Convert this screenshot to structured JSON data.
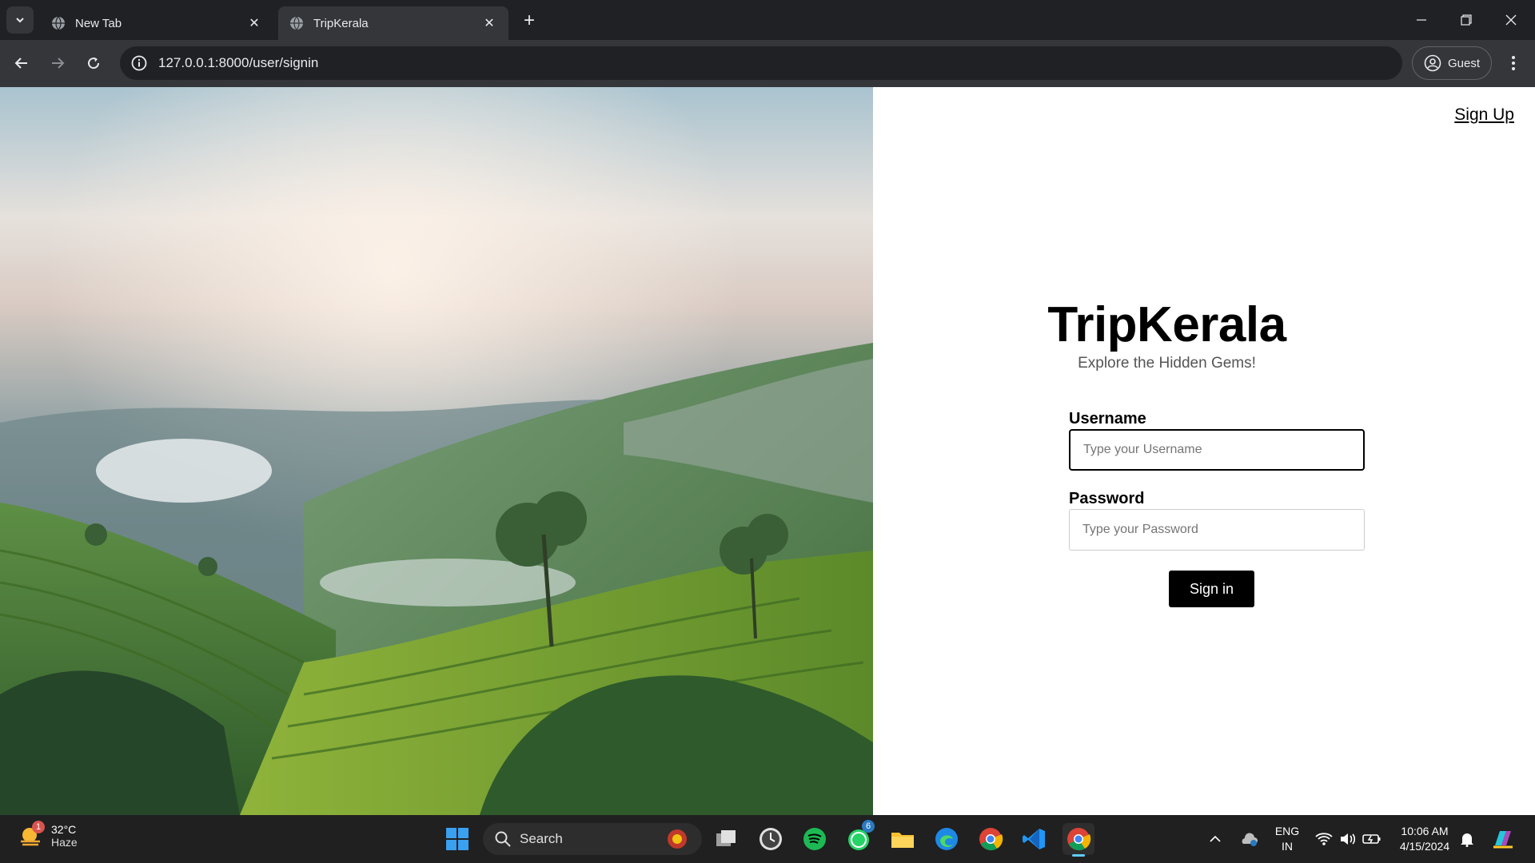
{
  "browser": {
    "tabs": [
      {
        "title": "New Tab",
        "active": false
      },
      {
        "title": "TripKerala",
        "active": true
      }
    ],
    "url": "127.0.0.1:8000/user/signin",
    "profile_label": "Guest"
  },
  "page": {
    "signup_link": "Sign Up",
    "brand": "TripKerala",
    "tagline": "Explore the Hidden Gems!",
    "username_label": "Username",
    "username_placeholder": "Type your Username",
    "password_label": "Password",
    "password_placeholder": "Type your Password",
    "signin_button": "Sign in"
  },
  "taskbar": {
    "weather_temp": "32°C",
    "weather_desc": "Haze",
    "weather_badge": "1",
    "search_label": "Search",
    "whatsapp_badge": "6",
    "lang_line1": "ENG",
    "lang_line2": "IN",
    "time": "10:06 AM",
    "date": "4/15/2024"
  },
  "colors": {
    "accent_chrome": "#202124",
    "button_bg": "#000000"
  }
}
